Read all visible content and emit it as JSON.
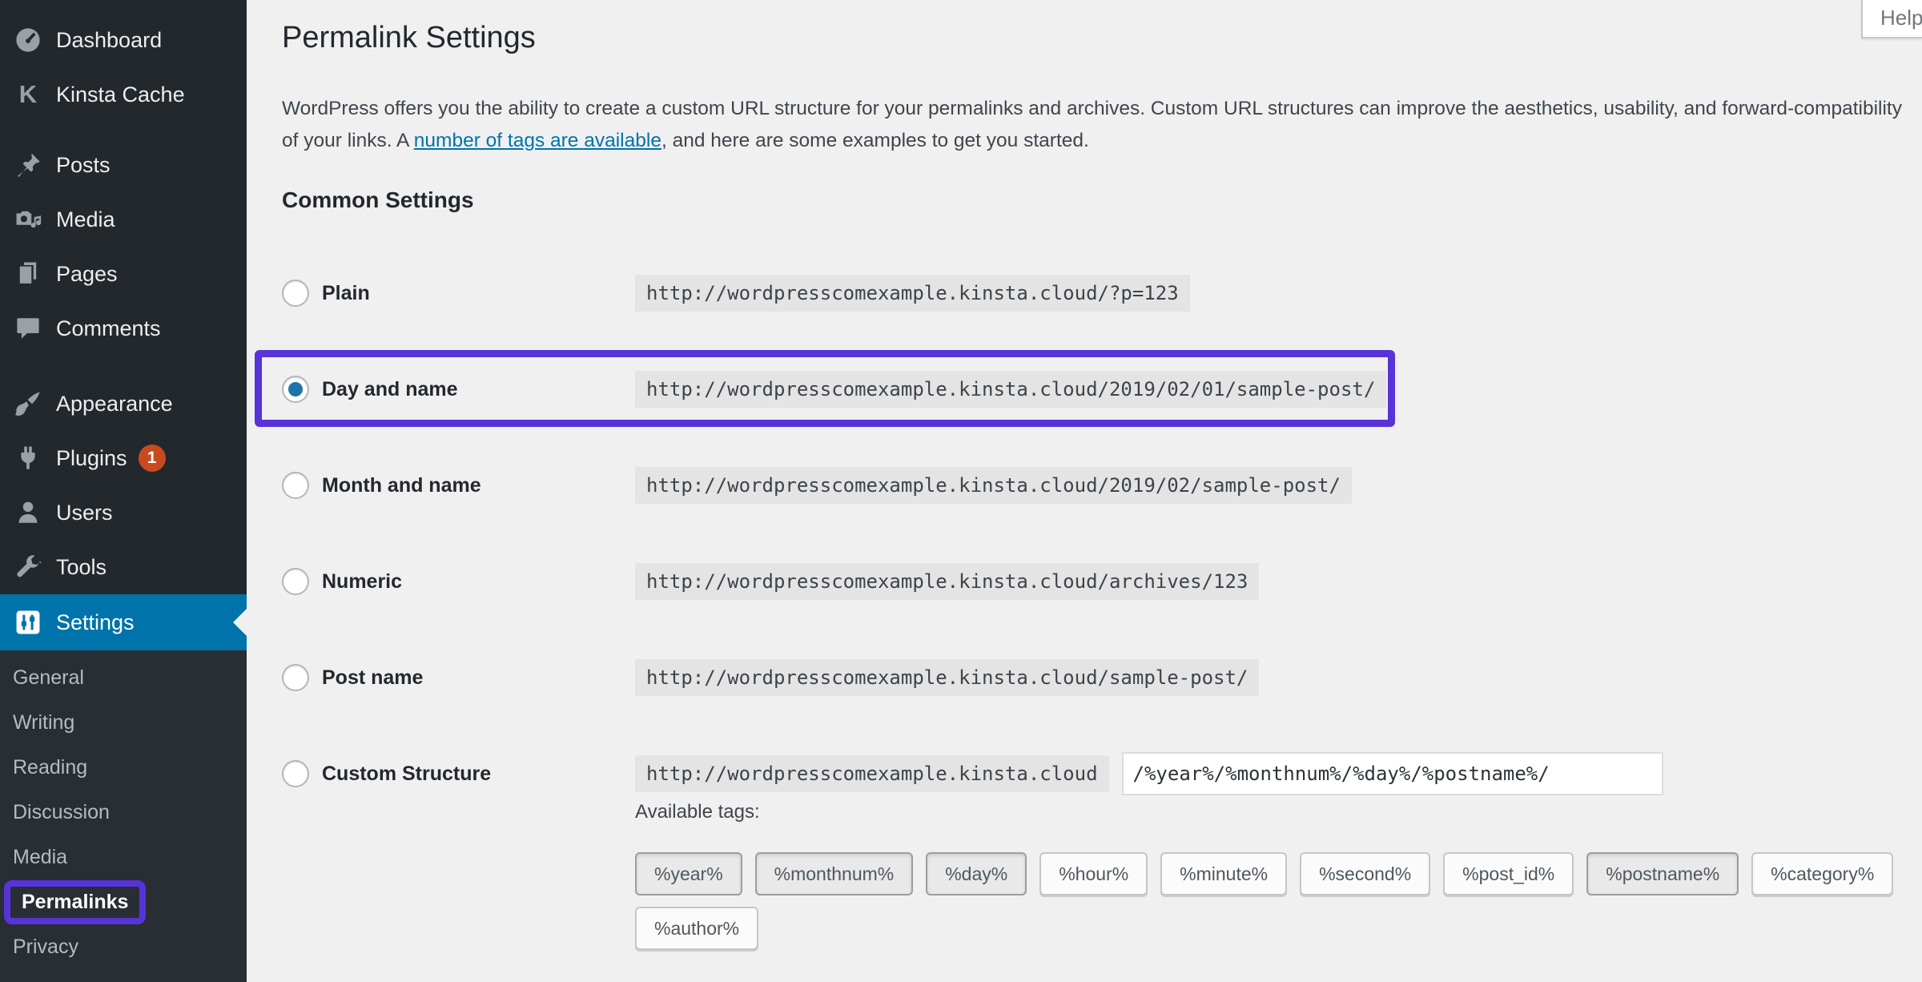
{
  "colors": {
    "sidebar_bg": "#23282d",
    "active_menu_blue": "#0073aa",
    "plugins_badge_red": "#ca4a1f",
    "annotation_purple": "#5733d9",
    "link_blue": "#0073aa",
    "radio_dot_blue": "#1e73a9",
    "page_bg": "#f0f0f1",
    "code_bg": "#e4e4e4"
  },
  "help": {
    "label": "Help"
  },
  "sidebar": {
    "items": [
      {
        "label": "Dashboard"
      },
      {
        "label": "Kinsta Cache"
      },
      {
        "label": "Posts"
      },
      {
        "label": "Media"
      },
      {
        "label": "Pages"
      },
      {
        "label": "Comments"
      },
      {
        "label": "Appearance"
      },
      {
        "label": "Plugins",
        "badge": "1"
      },
      {
        "label": "Users"
      },
      {
        "label": "Tools"
      },
      {
        "label": "Settings"
      }
    ],
    "settings_submenu": [
      {
        "label": "General"
      },
      {
        "label": "Writing"
      },
      {
        "label": "Reading"
      },
      {
        "label": "Discussion"
      },
      {
        "label": "Media"
      },
      {
        "label": "Permalinks"
      },
      {
        "label": "Privacy"
      }
    ]
  },
  "main": {
    "title": "Permalink Settings",
    "intro": {
      "before_link": "WordPress offers you the ability to create a custom URL structure for your permalinks and archives. Custom URL structures can improve the aesthetics, usability, and forward-compatibility of your links. A ",
      "link": "number of tags are available",
      "after_link": ", and here are some examples to get you started."
    },
    "section_heading": "Common Settings",
    "options": [
      {
        "label": "Plain",
        "url": "http://wordpresscomexample.kinsta.cloud/?p=123",
        "selected": false
      },
      {
        "label": "Day and name",
        "url": "http://wordpresscomexample.kinsta.cloud/2019/02/01/sample-post/",
        "selected": true
      },
      {
        "label": "Month and name",
        "url": "http://wordpresscomexample.kinsta.cloud/2019/02/sample-post/",
        "selected": false
      },
      {
        "label": "Numeric",
        "url": "http://wordpresscomexample.kinsta.cloud/archives/123",
        "selected": false
      },
      {
        "label": "Post name",
        "url": "http://wordpresscomexample.kinsta.cloud/sample-post/",
        "selected": false
      },
      {
        "label": "Custom Structure",
        "url_prefix": "http://wordpresscomexample.kinsta.cloud",
        "input_value": "/%year%/%monthnum%/%day%/%postname%/",
        "selected": false
      }
    ],
    "available_tags": {
      "label": "Available tags:",
      "tags": [
        {
          "label": "%year%",
          "active": true
        },
        {
          "label": "%monthnum%",
          "active": true
        },
        {
          "label": "%day%",
          "active": true
        },
        {
          "label": "%hour%",
          "active": false
        },
        {
          "label": "%minute%",
          "active": false
        },
        {
          "label": "%second%",
          "active": false
        },
        {
          "label": "%post_id%",
          "active": false
        },
        {
          "label": "%postname%",
          "active": true
        },
        {
          "label": "%category%",
          "active": false
        },
        {
          "label": "%author%",
          "active": false
        }
      ]
    }
  }
}
